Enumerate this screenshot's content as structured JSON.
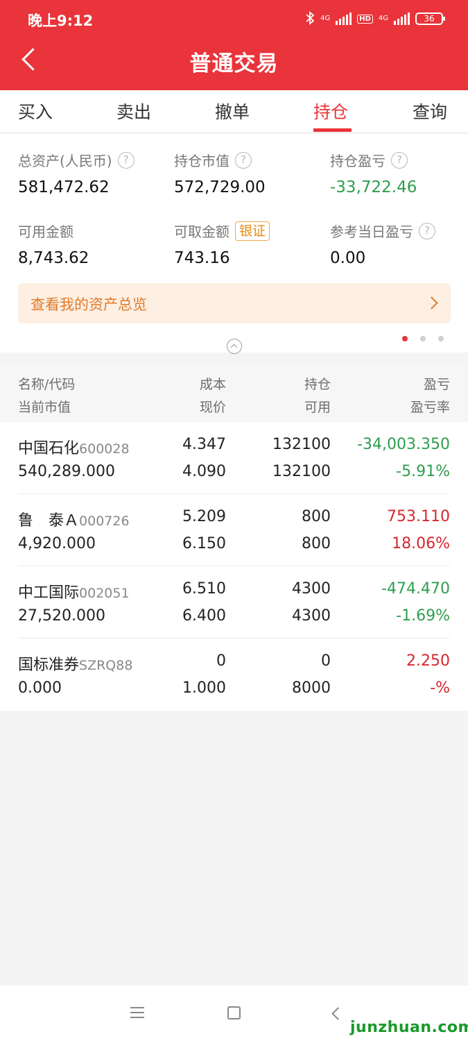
{
  "status_bar": {
    "time": "晚上9:12",
    "network_1": "4G",
    "hd": "HD",
    "network_2": "4G",
    "battery": "36"
  },
  "header": {
    "title": "普通交易",
    "back_icon": "chevron-left-icon"
  },
  "tabs": [
    {
      "label": "买入"
    },
    {
      "label": "卖出"
    },
    {
      "label": "撤单"
    },
    {
      "label": "持仓",
      "active": true
    },
    {
      "label": "查询"
    }
  ],
  "assets": {
    "total_label": "总资产(人民币)",
    "total_value": "581,472.62",
    "market_label": "持仓市值",
    "market_value": "572,729.00",
    "pnl_label": "持仓盈亏",
    "pnl_value": "-33,722.46",
    "avail_label": "可用金额",
    "avail_value": "8,743.62",
    "withdraw_label": "可取金额",
    "withdraw_badge": "银证",
    "withdraw_value": "743.16",
    "day_pnl_label": "参考当日盈亏",
    "day_pnl_value": "0.00",
    "help_glyph": "?",
    "banner": "查看我的资产总览"
  },
  "table_header": {
    "name_code": "名称/代码",
    "market_value": "当前市值",
    "cost": "成本",
    "price": "现价",
    "hold": "持仓",
    "avail": "可用",
    "pnl": "盈亏",
    "pnl_rate": "盈亏率"
  },
  "positions": [
    {
      "name": "中国石化",
      "code": "600028",
      "market_value": "540,289.000",
      "cost": "4.347",
      "price": "4.090",
      "hold": "132100",
      "avail": "132100",
      "pnl": "-34,003.350",
      "pnl_rate": "-5.91%",
      "trend": "loss"
    },
    {
      "name": "鲁　泰Ａ",
      "code": "000726",
      "market_value": "4,920.000",
      "cost": "5.209",
      "price": "6.150",
      "hold": "800",
      "avail": "800",
      "pnl": "753.110",
      "pnl_rate": "18.06%",
      "trend": "gain"
    },
    {
      "name": "中工国际",
      "code": "002051",
      "market_value": "27,520.000",
      "cost": "6.510",
      "price": "6.400",
      "hold": "4300",
      "avail": "4300",
      "pnl": "-474.470",
      "pnl_rate": "-1.69%",
      "trend": "loss"
    },
    {
      "name": "国标准券",
      "code": "SZRQ88",
      "market_value": "0.000",
      "cost": "0",
      "price": "1.000",
      "hold": "0",
      "avail": "8000",
      "pnl": "2.250",
      "pnl_rate": "-%",
      "trend": "gain"
    }
  ],
  "colors": {
    "brand_red": "#e8343a",
    "gain_red": "#d8262f",
    "loss_green": "#2d9e4e",
    "banner_orange": "#e07b2a"
  },
  "watermark": "junzhuan.com"
}
